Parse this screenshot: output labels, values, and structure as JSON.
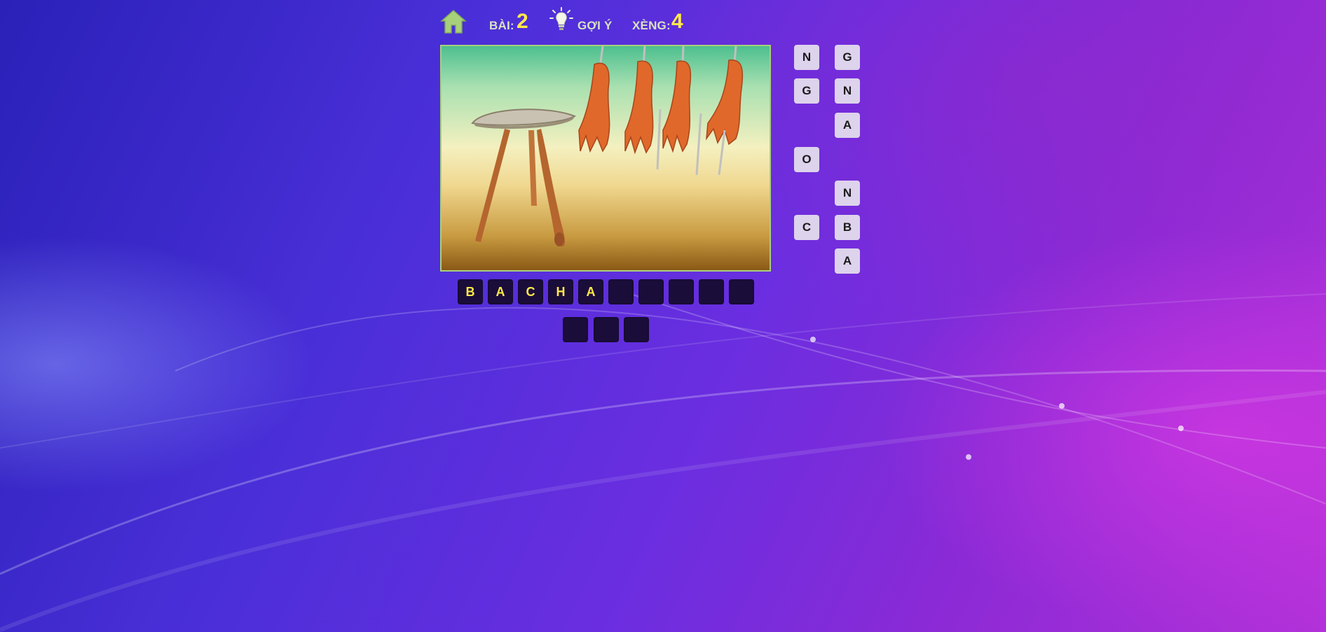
{
  "topbar": {
    "home_icon": "home-icon",
    "level_label": "BÀI:",
    "level_value": "2",
    "hint_icon": "lightbulb-icon",
    "hint_label": "GỢI Ý",
    "coins_label": "XÈNG:",
    "coins_value": "4"
  },
  "colors": {
    "accent_yellow": "#ffe94a",
    "label_green": "#d8e3c4",
    "slot_bg": "#1a0d3a",
    "tile_bg": "#ddd3ec"
  },
  "puzzle": {
    "image_description_icon": "puzzle-picture",
    "answer_row1": [
      "B",
      "A",
      "C",
      "H",
      "A",
      "",
      "",
      "",
      "",
      ""
    ],
    "answer_row2": [
      "",
      "",
      ""
    ]
  },
  "letters": {
    "col1": [
      "N",
      "G",
      "",
      "O",
      "",
      "C",
      ""
    ],
    "col2": [
      "G",
      "N",
      "A",
      "",
      "N",
      "B",
      "A"
    ]
  }
}
